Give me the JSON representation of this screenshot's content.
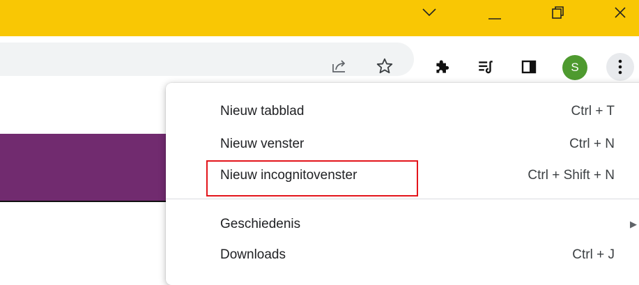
{
  "window": {
    "controls": {
      "chevron": "chevron-down-icon",
      "minimize": "minimize-icon",
      "restore": "restore-icon",
      "close": "close-icon"
    }
  },
  "toolbar": {
    "icons": [
      "share-icon",
      "star-icon",
      "extensions-icon",
      "reading-list-icon",
      "side-panel-icon",
      "kebab-menu-icon"
    ],
    "profile_initial": "S",
    "profile_color": "#4e9a2f"
  },
  "page": {
    "band_color": "#712b6f"
  },
  "menu": {
    "items": [
      {
        "label": "Nieuw tabblad",
        "shortcut": "Ctrl + T"
      },
      {
        "label": "Nieuw venster",
        "shortcut": "Ctrl + N"
      },
      {
        "label": "Nieuw incognitovenster",
        "shortcut": "Ctrl + Shift + N",
        "highlighted": true
      },
      {
        "label": "Geschiedenis",
        "shortcut": "",
        "submenu": true
      },
      {
        "label": "Downloads",
        "shortcut": "Ctrl + J"
      }
    ],
    "highlight_color": "#e3141b"
  },
  "colors": {
    "titlebar": "#f9c704",
    "omnibox": "#f1f3f4"
  }
}
